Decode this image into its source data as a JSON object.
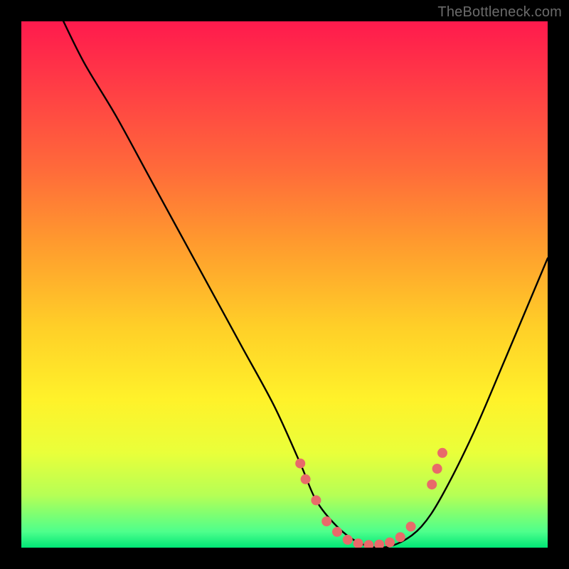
{
  "watermark": "TheBottleneck.com",
  "chart_data": {
    "type": "line",
    "title": "",
    "xlabel": "",
    "ylabel": "",
    "xlim": [
      0,
      100
    ],
    "ylim": [
      0,
      100
    ],
    "grid": false,
    "legend": false,
    "series": [
      {
        "name": "curve",
        "x": [
          8,
          12,
          18,
          24,
          30,
          36,
          42,
          48,
          53,
          56,
          60,
          64,
          68,
          72,
          76,
          80,
          86,
          92,
          100
        ],
        "y": [
          100,
          92,
          82,
          71,
          60,
          49,
          38,
          27,
          16,
          9,
          4,
          1,
          0,
          1,
          4,
          10,
          22,
          36,
          55
        ]
      }
    ],
    "markers": {
      "name": "highlight-dots",
      "color": "#e86a6a",
      "points": [
        {
          "x": 53,
          "y": 16
        },
        {
          "x": 54,
          "y": 13
        },
        {
          "x": 56,
          "y": 9
        },
        {
          "x": 58,
          "y": 5
        },
        {
          "x": 60,
          "y": 3
        },
        {
          "x": 62,
          "y": 1.5
        },
        {
          "x": 64,
          "y": 0.8
        },
        {
          "x": 66,
          "y": 0.5
        },
        {
          "x": 68,
          "y": 0.6
        },
        {
          "x": 70,
          "y": 1
        },
        {
          "x": 72,
          "y": 2
        },
        {
          "x": 74,
          "y": 4
        },
        {
          "x": 78,
          "y": 12
        },
        {
          "x": 79,
          "y": 15
        },
        {
          "x": 80,
          "y": 18
        }
      ]
    },
    "background_gradient": {
      "top": "#ff1a4d",
      "mid": "#fff22a",
      "bottom": "#00e676"
    }
  }
}
